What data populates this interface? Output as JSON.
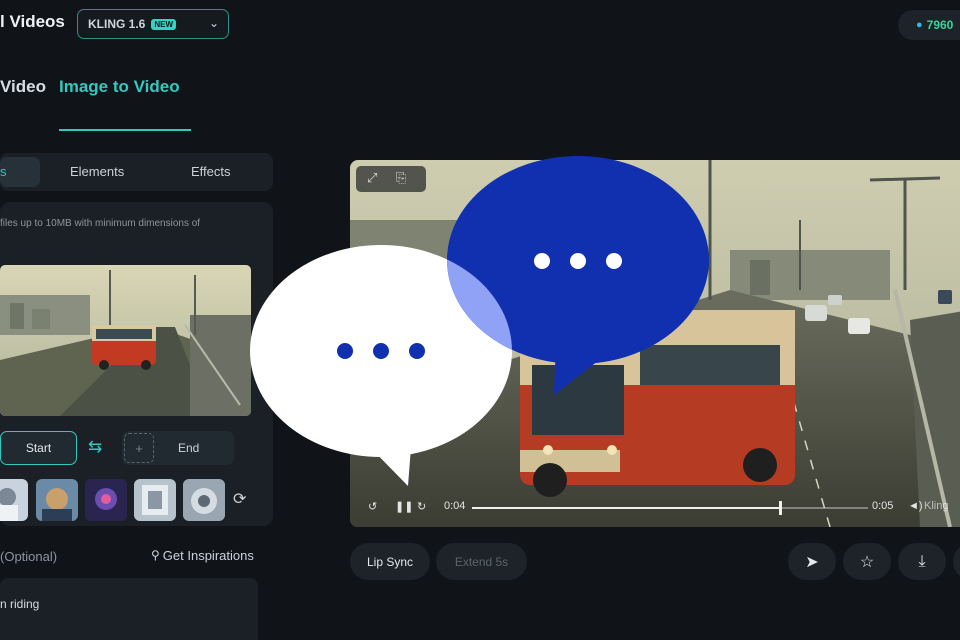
{
  "header": {
    "title": "l Videos",
    "model": {
      "name": "KLING 1.6",
      "badge": "NEW",
      "chevron": "⌄"
    },
    "credits": {
      "icon": "drop-icon",
      "value": "7960"
    }
  },
  "tabs": {
    "previous": "Video",
    "active": "Image to Video"
  },
  "subtabs": {
    "active": "s",
    "items": [
      "Elements",
      "Effects"
    ]
  },
  "upload": {
    "hint": "files up to 10MB with minimum dimensions of",
    "start_label": "Start",
    "end_label": "End",
    "plus": "+",
    "swap": "⇆",
    "refresh": "⟳"
  },
  "prompt": {
    "label": "(Optional)",
    "inspire_label": "Get Inspirations",
    "text": "n riding"
  },
  "player": {
    "current_time": "0:04",
    "duration": "0:05",
    "progress": 0.78,
    "watermark": "Kling",
    "play_icon": "pause-icon"
  },
  "actions": {
    "lip_sync": "Lip Sync",
    "extend": "Extend 5s"
  },
  "overlay": {
    "bubbles": [
      "speech-bubble-white",
      "speech-bubble-blue"
    ],
    "colors": {
      "blue_bubble": "#1130b0",
      "white_bubble": "#ffffff",
      "accent": "#34c8bf"
    }
  }
}
